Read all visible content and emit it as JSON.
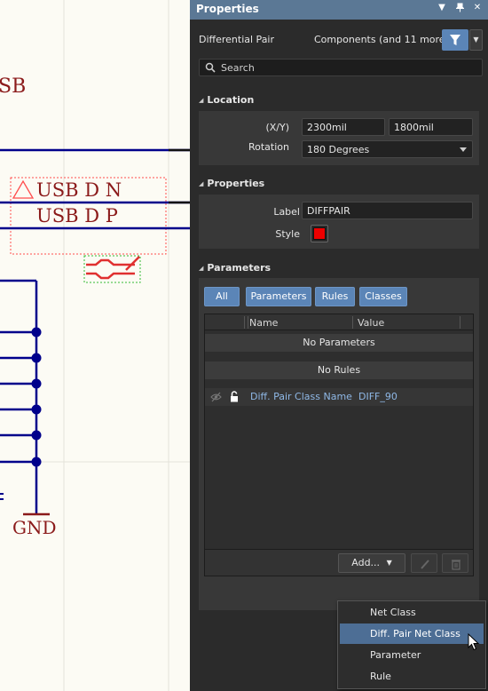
{
  "schematic": {
    "fragment_label": "SB",
    "net_label_1": "USB D N",
    "net_label_2": "USB D P",
    "power_label": "GND",
    "colors": {
      "wire": "#00008b",
      "text": "#8b1a1a",
      "selection": "#ff4d4d",
      "directive": "#e03030"
    }
  },
  "panel": {
    "title": "Properties",
    "controls": {
      "menu_icon": "chevron-down-icon",
      "pin_icon": "pin-icon",
      "close_icon": "close-icon"
    },
    "object_type": "Differential Pair",
    "filter_text": "Components (and 11 more)",
    "search_placeholder": "Search",
    "accent_color": "#5b85b7"
  },
  "location": {
    "header": "Location",
    "xy_label": "(X/Y)",
    "x_value": "2300mil",
    "y_value": "1800mil",
    "rotation_label": "Rotation",
    "rotation_value": "180 Degrees"
  },
  "properties": {
    "header": "Properties",
    "label_label": "Label",
    "label_value": "DIFFPAIR",
    "style_label": "Style",
    "style_color": "#ee0000"
  },
  "parameters": {
    "header": "Parameters",
    "tabs": [
      "All",
      "Parameters",
      "Rules",
      "Classes"
    ],
    "columns": {
      "name": "Name",
      "value": "Value"
    },
    "groups": [
      "No Parameters",
      "No Rules"
    ],
    "rows": [
      {
        "name": "Diff. Pair Class Name",
        "value": "DIFF_90"
      }
    ],
    "add_button": "Add...",
    "edit_icon": "pencil-icon",
    "delete_icon": "trash-icon"
  },
  "add_menu": {
    "items": [
      "Net Class",
      "Diff. Pair Net Class",
      "Parameter",
      "Rule"
    ],
    "highlighted": "Diff. Pair Net Class"
  }
}
